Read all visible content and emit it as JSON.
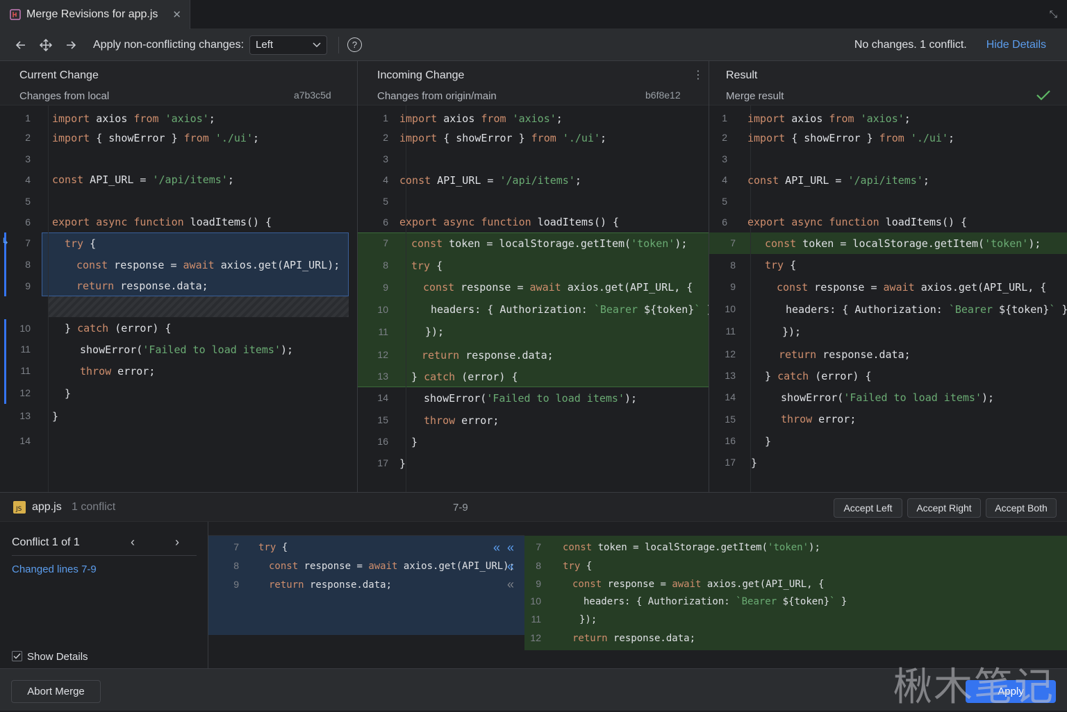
{
  "window": {
    "tab_title": "Merge Revisions for app.js",
    "close_glyph": "✕",
    "collapse_glyph": "⤡"
  },
  "toolbar": {
    "apply_label": "Apply non-conflicting changes:",
    "apply_value": "Left",
    "help_glyph": "?",
    "status": "No changes. 1 conflict.",
    "hide_details": "Hide Details"
  },
  "left": {
    "title": "Current Change",
    "subtitle": "Changes from local",
    "hash": "a7b3c5d",
    "line_numbers": [
      "1",
      "2",
      "3",
      "4",
      "5",
      "6",
      "7",
      "8",
      "9",
      "10",
      "11",
      "11",
      "12",
      "13",
      "14"
    ]
  },
  "middle": {
    "title": "Incoming Change",
    "subtitle": "Changes from origin/main",
    "hash": "b6f8e12",
    "line_numbers": [
      "1",
      "2",
      "3",
      "4",
      "5",
      "6",
      "7",
      "8",
      "9",
      "10",
      "11",
      "12",
      "13",
      "14",
      "15",
      "16",
      "17"
    ]
  },
  "right": {
    "title": "Result",
    "subtitle": "Merge result",
    "line_numbers": [
      "1",
      "2",
      "3",
      "4",
      "5",
      "6",
      "7",
      "8",
      "9",
      "10",
      "11",
      "12",
      "13",
      "14",
      "15",
      "16",
      "17"
    ]
  },
  "bottom": {
    "file_name": "app.js",
    "conflict_count": "1 conflict",
    "range": "7-9",
    "accept_left": "Accept Left",
    "accept_right": "Accept Right",
    "accept_both": "Accept Both",
    "conflict_title": "Conflict 1 of 1",
    "changed_lines": "Changed lines 7-9",
    "show_details": "Show Details",
    "left_line_numbers": [
      "7",
      "8",
      "9"
    ],
    "right_line_numbers": [
      "7",
      "8",
      "9",
      "10",
      "11",
      "12"
    ]
  },
  "footer": {
    "abort": "Abort Merge",
    "apply": "Apply"
  },
  "watermark": "楸木笔记",
  "colors": {
    "accent": "#3574f0",
    "link": "#5c9ded",
    "conflict_blue": "#223247",
    "incoming_green": "#263d25",
    "keyword": "#cf8e6d",
    "string": "#6aab73",
    "check": "#5fb865"
  }
}
